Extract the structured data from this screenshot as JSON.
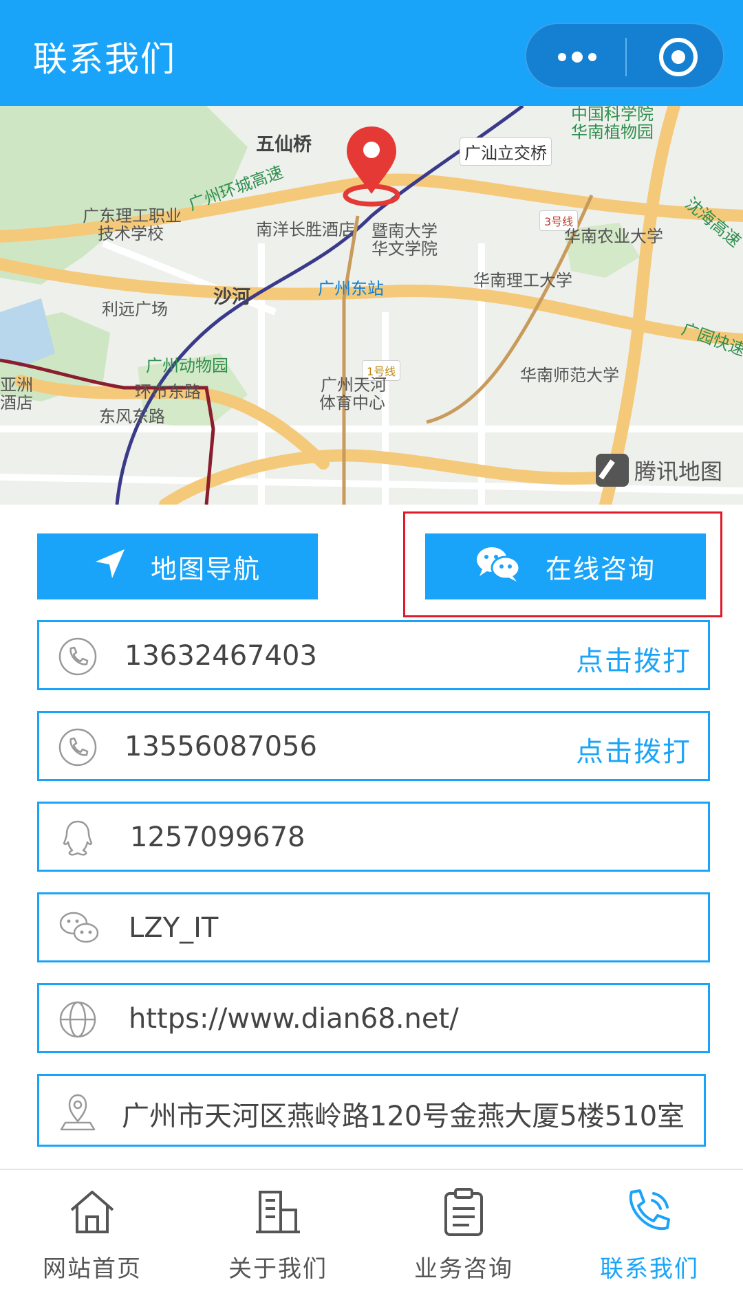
{
  "header": {
    "title": "联系我们"
  },
  "map": {
    "labels": [
      "五仙桥",
      "中国科学院",
      "华南植物园",
      "广汕立交桥",
      "广州环城高速",
      "广东理工职业",
      "技术学校",
      "南洋长胜酒店",
      "暨南大学",
      "华文学院",
      "3号线",
      "华南农业大学",
      "沈海高速",
      "广州东站",
      "华南理工大学",
      "沙河",
      "利远广场",
      "广园快速",
      "广州动物园",
      "1号线",
      "广州天河",
      "体育中心",
      "华南师范大学",
      "亚洲",
      "酒店",
      "环市东路",
      "东风东路"
    ],
    "provider": "腾讯地图"
  },
  "actions": {
    "nav_label": "地图导航",
    "consult_label": "在线咨询"
  },
  "contacts": [
    {
      "icon": "phone-icon",
      "text": "13632467403",
      "action": "点击拨打"
    },
    {
      "icon": "phone-icon",
      "text": "13556087056",
      "action": "点击拨打"
    },
    {
      "icon": "qq-icon",
      "text": "1257099678"
    },
    {
      "icon": "wechat-icon",
      "text": "LZY_IT"
    },
    {
      "icon": "globe-icon",
      "text": "https://www.dian68.net/"
    },
    {
      "icon": "location-icon",
      "text": "广州市天河区燕岭路120号金燕大厦5楼510室"
    }
  ],
  "tabs": [
    {
      "label": "网站首页",
      "icon": "home-icon"
    },
    {
      "label": "关于我们",
      "icon": "building-icon"
    },
    {
      "label": "业务咨询",
      "icon": "clipboard-icon"
    },
    {
      "label": "联系我们",
      "icon": "phone-call-icon"
    }
  ],
  "colors": {
    "primary": "#1aa4f9",
    "highlight": "#e1192a"
  }
}
